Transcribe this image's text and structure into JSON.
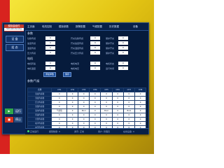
{
  "app": {
    "logo_line1": "模拟量组件",
    "logo_line2": "SimulatorAnalog"
  },
  "sidebar": {
    "btn1": "设 备",
    "btn2": "组 态",
    "btn3": "运行",
    "btn4": "停止"
  },
  "tabs": [
    "主页面",
    "电机控制",
    "模拟参数",
    "报警配置",
    "气候配置",
    "历史数据",
    "设备"
  ],
  "sections": {
    "s1": "参数",
    "s1_rows": [
      {
        "a": "位移传感",
        "v1": "0",
        "b": "开关位移传感",
        "v2": "0",
        "c": "保护开关",
        "v3": "0"
      },
      {
        "a": "速度传感",
        "v1": "0",
        "b": "开关速度传感",
        "v2": "0",
        "c": "保护开关",
        "v3": "0"
      },
      {
        "a": "温度传感",
        "v1": "0",
        "b": "开关温度传感",
        "v2": "0",
        "c": "保护开关",
        "v3": "0"
      },
      {
        "a": "压力传感",
        "v1": "0",
        "b": "开关压力传感",
        "v2": "0",
        "c": "保护开关",
        "v3": "0"
      }
    ],
    "s2": "电机",
    "s2_rows": [
      {
        "a": "电机转速",
        "v1": "0",
        "b": "电机电流",
        "v2": "0",
        "c": "电机状态",
        "v3": "0"
      },
      {
        "a": "电机温度",
        "v1": "0",
        "b": "电机电压",
        "v2": "0",
        "c": "运行时间",
        "v3": "0"
      }
    ],
    "s3": "参数/气候",
    "btn_add": "添加参数",
    "btn_save": "保存"
  },
  "table": {
    "headers": [
      "名称",
      "CH1",
      "CH2",
      "CH3",
      "CH4",
      "CH5",
      "CH6",
      "CH7",
      "CH8"
    ],
    "rows": [
      [
        "温度传感器",
        "0",
        "0",
        "0",
        "0",
        "0",
        "0",
        "0",
        "0"
      ],
      [
        "湿度传感器",
        "0",
        "0",
        "0",
        "0",
        "0",
        "0",
        "0",
        "0"
      ],
      [
        "压力传感器",
        "0",
        "0",
        "0",
        "0",
        "0",
        "0",
        "0",
        "0"
      ],
      [
        "流量传感器",
        "0",
        "0",
        "0",
        "0",
        "0",
        "0",
        "0",
        "0"
      ],
      [
        "液位传感器",
        "气候值",
        "0",
        "Bool",
        "0",
        "Bool",
        "0",
        "Bool",
        "0"
      ],
      [
        "风速传感器",
        "0",
        "0",
        "0",
        "0",
        "0",
        "0",
        "0",
        "0"
      ],
      [
        "光照传感器",
        "0",
        "0",
        "0",
        "0",
        "0",
        "0",
        "0",
        "0"
      ],
      [
        "噪声传感器",
        "0",
        "0",
        "0",
        "0",
        "0",
        "0",
        "0",
        "0"
      ],
      [
        "电压传感器",
        "0",
        "0",
        "0",
        "0",
        "0",
        "0",
        "0",
        "0"
      ]
    ]
  },
  "status": {
    "left": "正常运行",
    "s2": "报警数量: 0",
    "s3": "通讯: 正常",
    "s4": "用户: 管理员",
    "s5": "在线设备: 0"
  },
  "colors": {
    "red_strip": "#d8231f",
    "gold": "#e4c514",
    "window": "#061b3c",
    "accent_green": "#2fa84a",
    "accent_red": "#d9341f"
  }
}
